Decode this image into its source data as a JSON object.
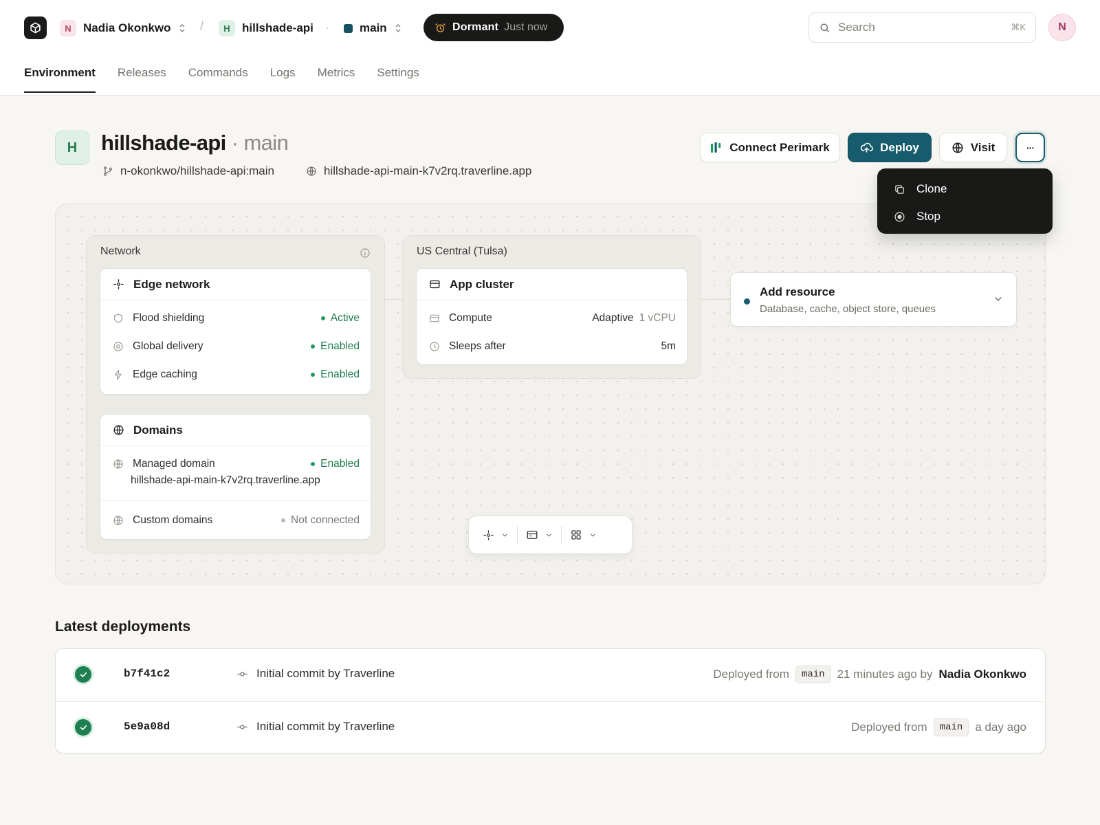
{
  "nav": {
    "org": {
      "initial": "N",
      "name": "Nadia Okonkwo"
    },
    "project": {
      "initial": "H",
      "name": "hillshade-api"
    },
    "branch": "main",
    "status": {
      "label": "Dormant",
      "time": "Just now"
    },
    "search": {
      "placeholder": "Search",
      "shortcut": "⌘K"
    },
    "avatar_initial": "N"
  },
  "tabs": [
    "Environment",
    "Releases",
    "Commands",
    "Logs",
    "Metrics",
    "Settings"
  ],
  "project": {
    "initial": "H",
    "name": "hillshade-api",
    "branch_suffix": "· main",
    "repo": "n-okonkwo/hillshade-api:main",
    "url": "hillshade-api-main-k7v2rq.traverline.app"
  },
  "actions": {
    "connect": "Connect Perimark",
    "deploy": "Deploy",
    "visit": "Visit",
    "more": "···"
  },
  "menu": {
    "clone": "Clone",
    "stop": "Stop"
  },
  "canvas": {
    "network": {
      "title": "Network",
      "edge": {
        "title": "Edge network",
        "rows": [
          {
            "label": "Flood shielding",
            "status": "Active"
          },
          {
            "label": "Global delivery",
            "status": "Enabled"
          },
          {
            "label": "Edge caching",
            "status": "Enabled"
          }
        ]
      },
      "domains": {
        "title": "Domains",
        "managed_label": "Managed domain",
        "managed_status": "Enabled",
        "managed_url": "hillshade-api-main-k7v2rq.traverline.app",
        "custom_label": "Custom domains",
        "custom_status": "Not connected"
      }
    },
    "region": {
      "title": "US Central (Tulsa)",
      "cluster": {
        "title": "App cluster",
        "compute_label": "Compute",
        "compute_value": "Adaptive",
        "compute_unit": "1 vCPU",
        "sleep_label": "Sleeps after",
        "sleep_value": "5m"
      }
    },
    "add_resource": {
      "title": "Add resource",
      "subtitle": "Database, cache, object store, queues"
    }
  },
  "deployments": {
    "title": "Latest deployments",
    "items": [
      {
        "hash": "b7f41c2",
        "message": "Initial commit by Traverline",
        "from_label": "Deployed from",
        "branch": "main",
        "time": "21 minutes ago by",
        "author": "Nadia Okonkwo"
      },
      {
        "hash": "5e9a08d",
        "message": "Initial commit by Traverline",
        "from_label": "Deployed from",
        "branch": "main",
        "time": "a day ago",
        "author": ""
      }
    ]
  },
  "colors": {
    "accent": "#175c6d",
    "success": "#1e9a5d",
    "dark": "#191918"
  }
}
